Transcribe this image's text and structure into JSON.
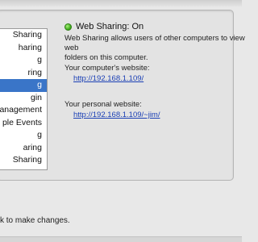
{
  "services": [
    {
      "label": "Sharing",
      "selected": false
    },
    {
      "label": "haring",
      "selected": false
    },
    {
      "label": "g",
      "selected": false
    },
    {
      "label": "ring",
      "selected": false
    },
    {
      "label": "g",
      "selected": true
    },
    {
      "label": "gin",
      "selected": false
    },
    {
      "label": "anagement",
      "selected": false
    },
    {
      "label": "ple Events",
      "selected": false
    },
    {
      "label": "g",
      "selected": false
    },
    {
      "label": "aring",
      "selected": false
    },
    {
      "label": "Sharing",
      "selected": false
    }
  ],
  "status": {
    "title": "Web Sharing: On",
    "light_color": "#3caa18"
  },
  "description": "Web Sharing allows users of other computers to view web\nfolders on this computer.",
  "computer_site": {
    "label": "Your computer's website:",
    "url": "http://192.168.1.109/"
  },
  "personal_site": {
    "label": "Your personal website:",
    "url": "http://192.168.1.109/~jim/"
  },
  "lock": {
    "text": "k to make changes."
  },
  "colors": {
    "selection": "#3a75c8",
    "link": "#1a3fb5"
  }
}
